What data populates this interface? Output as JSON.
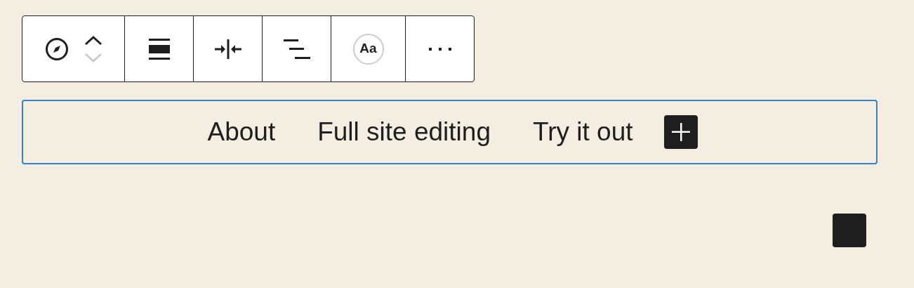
{
  "toolbar": {
    "move_up_disabled": false,
    "move_down_disabled": true,
    "typography_label": "Aa"
  },
  "navigation": {
    "selected": true,
    "items": [
      {
        "label": "About"
      },
      {
        "label": "Full site editing"
      },
      {
        "label": "Try it out"
      }
    ]
  }
}
